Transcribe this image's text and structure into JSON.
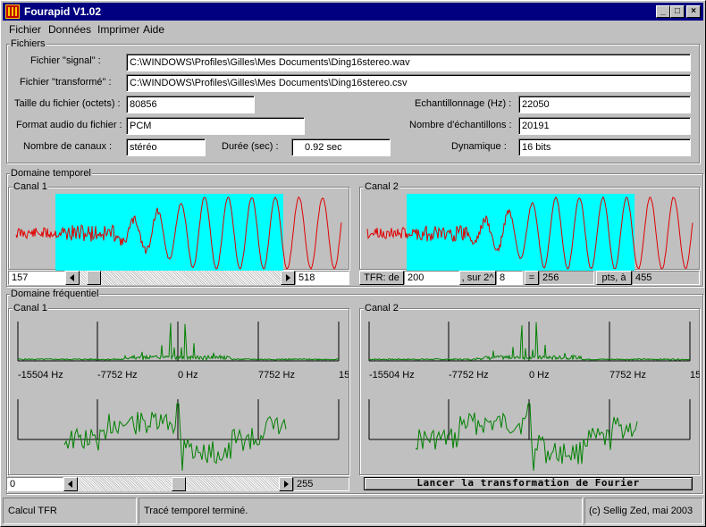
{
  "window": {
    "title": "Fourapid V1.02"
  },
  "titlebar_buttons": {
    "minimize": "_",
    "maximize": "□",
    "close": "×"
  },
  "menu": [
    {
      "label": "Fichier",
      "accel": "F"
    },
    {
      "label": "Données",
      "accel": "D"
    },
    {
      "label": "Imprimer",
      "accel": "m"
    },
    {
      "label": "Aide",
      "accel": "A"
    }
  ],
  "fichiers": {
    "group_label": "Fichiers",
    "signal_label": "Fichier \"signal\" :",
    "signal_value": "C:\\WINDOWS\\Profiles\\Gilles\\Mes Documents\\Ding16stereo.wav",
    "transforme_label": "Fichier \"transformé\" :",
    "transforme_value": "C:\\WINDOWS\\Profiles\\Gilles\\Mes Documents\\Ding16stereo.csv",
    "taille_label": "Taille du fichier (octets) :",
    "taille_value": "80856",
    "format_label": "Format audio du fichier :",
    "format_value": "PCM",
    "canaux_label": "Nombre de canaux :",
    "canaux_value": "stéréo",
    "duree_label": "Durée (sec) :",
    "duree_value": "0.92 sec",
    "echant_label": "Echantillonnage (Hz) :",
    "echant_value": "22050",
    "nb_echant_label": "Nombre d'échantillons :",
    "nb_echant_value": "20191",
    "dynamique_label": "Dynamique :",
    "dynamique_value": "16 bits"
  },
  "temporel": {
    "group_label": "Domaine temporel",
    "canal1_label": "Canal 1",
    "canal2_label": "Canal 2",
    "scroll_start": "157",
    "scroll_end": "518",
    "scroll_position": 0.04,
    "tfr_label": "TFR: de",
    "tfr_de": "200",
    "sur_label": ", sur 2^",
    "sur_value": "8",
    "eq_label": "=",
    "eq_value": "256",
    "pts_label": "pts, à",
    "pts_value": "455"
  },
  "frequentiel": {
    "group_label": "Domaine fréquentiel",
    "canal1_label": "Canal 1",
    "canal2_label": "Canal 2",
    "axis_labels": [
      "-15504 Hz",
      "-7752 Hz",
      "0 Hz",
      "7752 Hz",
      "15"
    ],
    "scroll_start": "0",
    "scroll_end": "255",
    "scroll_position": 0.5,
    "launch_button": "Lancer la transformation de Fourier"
  },
  "status": {
    "left": "Calcul TFR",
    "middle": "Tracé temporel terminé.",
    "right": "(c) Sellig Zed, mai 2003"
  },
  "colors": {
    "title_bar": "#000080",
    "highlight": "#00ffff",
    "time_signal": "#e00000",
    "freq_signal": "#008000",
    "window_bg": "#c0c0c0"
  }
}
